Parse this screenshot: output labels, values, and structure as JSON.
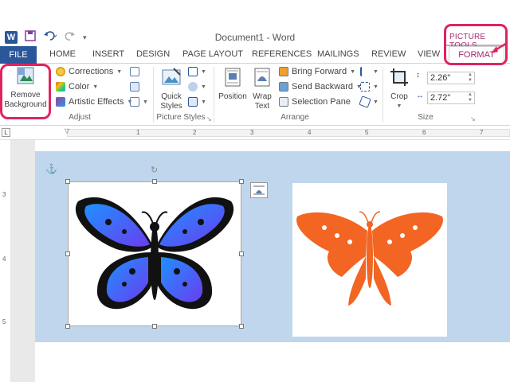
{
  "window": {
    "title": "Document1 - Word",
    "app_icon_letter": "W",
    "contextual_group": "PICTURE TOOLS"
  },
  "qat": {
    "save_icon": "save-icon",
    "undo_icon": "undo-icon",
    "redo_icon": "redo-icon",
    "customize_icon": "customize-qat-icon"
  },
  "tabs": [
    "FILE",
    "HOME",
    "INSERT",
    "DESIGN",
    "PAGE LAYOUT",
    "REFERENCES",
    "MAILINGS",
    "REVIEW",
    "VIEW",
    "FORMAT"
  ],
  "ribbon": {
    "adjust": {
      "label": "Adjust",
      "remove_bg_line1": "Remove",
      "remove_bg_line2": "Background",
      "corrections": "Corrections",
      "color": "Color",
      "artistic": "Artistic Effects"
    },
    "picture_styles": {
      "label": "Picture Styles",
      "quick_line1": "Quick",
      "quick_line2": "Styles"
    },
    "arrange": {
      "label": "Arrange",
      "position": "Position",
      "wrap_line1": "Wrap",
      "wrap_line2": "Text",
      "bring_forward": "Bring Forward",
      "send_backward": "Send Backward",
      "selection_pane": "Selection Pane"
    },
    "size": {
      "label": "Size",
      "crop": "Crop",
      "height": "2.26\"",
      "width": "2.72\""
    }
  },
  "ruler": {
    "h_numbers": [
      "1",
      "2",
      "3",
      "4",
      "5",
      "6",
      "7"
    ],
    "v_numbers": [
      "3",
      "4",
      "5"
    ],
    "corner": "L"
  },
  "colors": {
    "accent": "#2b579a",
    "format_tab": "#a42874",
    "highlight": "#e0245e",
    "doc_bg": "#c0d6ec",
    "butterfly_blue": "#1e90ff",
    "butterfly_purple": "#6a3df0",
    "butterfly_orange": "#f26522"
  }
}
